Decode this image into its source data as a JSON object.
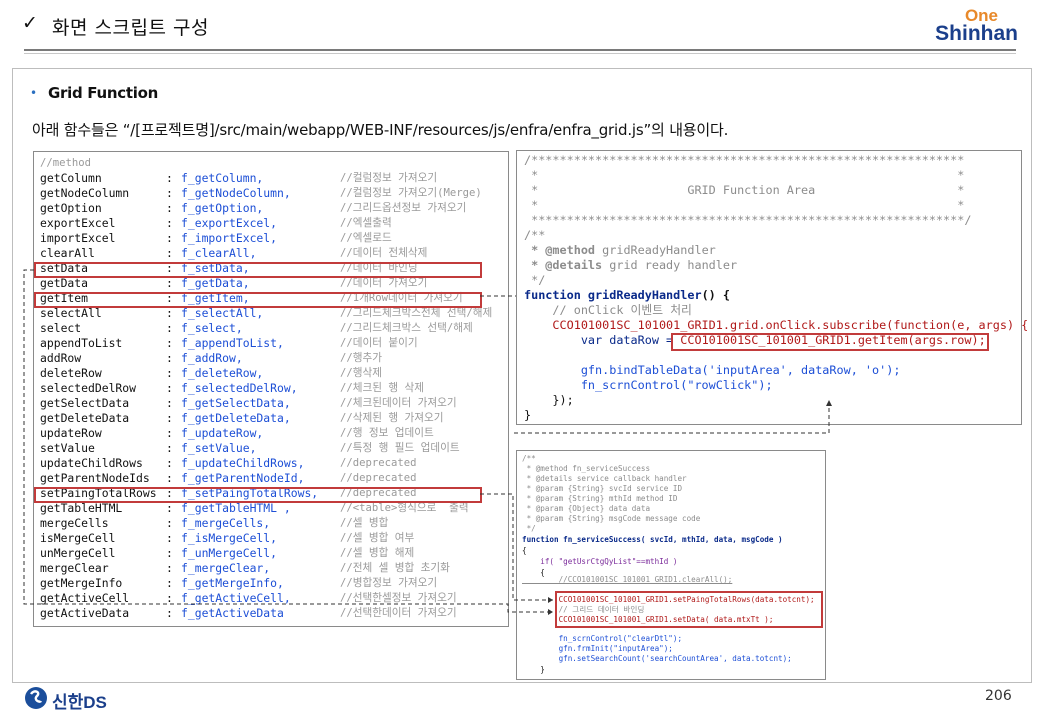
{
  "header": {
    "check": "✓",
    "title": "화면 스크립트 구성",
    "logo_top": "One",
    "logo_main": "Shinhan"
  },
  "section": {
    "bullet": "•",
    "title": "Grid Function",
    "description": "아래 함수들은 “/[프로젝트명]/src/main/webapp/WEB-INF/resources/js/enfra/enfra_grid.js”의 내용이다."
  },
  "left_code": {
    "header": "//method",
    "rows": [
      {
        "name": "getColumn",
        "fn": "f_getColumn,",
        "comment": "//컬럼정보 가져오기"
      },
      {
        "name": "getNodeColumn",
        "fn": "f_getNodeColumn,",
        "comment": "//컬럼정보 가져오기(Merge)"
      },
      {
        "name": "getOption",
        "fn": "f_getOption,",
        "comment": "//그리드옵션정보 가져오기"
      },
      {
        "name": "exportExcel",
        "fn": "f_exportExcel,",
        "comment": "//엑셀출력"
      },
      {
        "name": "importExcel",
        "fn": "f_importExcel,",
        "comment": "//엑셀로드"
      },
      {
        "name": "clearAll",
        "fn": "f_clearAll,",
        "comment": "//데이터 전체삭제"
      },
      {
        "name": "setData",
        "fn": "f_setData,",
        "comment": "//데이터 바인딩"
      },
      {
        "name": "getData",
        "fn": "f_getData,",
        "comment": "//데이터 가져오기"
      },
      {
        "name": "getItem",
        "fn": "f_getItem,",
        "comment": "//1개Row데이터 가져오기"
      },
      {
        "name": "selectAll",
        "fn": "f_selectAll,",
        "comment": "//그리드체크박스전체 선택/해제"
      },
      {
        "name": "select",
        "fn": "f_select,",
        "comment": "//그리드체크박스 선택/해제"
      },
      {
        "name": "appendToList",
        "fn": "f_appendToList,",
        "comment": "//데이터 붙이기"
      },
      {
        "name": "addRow",
        "fn": "f_addRow,",
        "comment": "//행추가"
      },
      {
        "name": "deleteRow",
        "fn": "f_deleteRow,",
        "comment": "//행삭제"
      },
      {
        "name": "selectedDelRow",
        "fn": "f_selectedDelRow,",
        "comment": "//체크된 행 삭제"
      },
      {
        "name": "getSelectData",
        "fn": "f_getSelectData,",
        "comment": "//체크된데이터 가져오기"
      },
      {
        "name": "getDeleteData",
        "fn": "f_getDeleteData,",
        "comment": "//삭제된 행 가져오기"
      },
      {
        "name": "updateRow",
        "fn": "f_updateRow,",
        "comment": "//행 정보 업데이트"
      },
      {
        "name": "setValue",
        "fn": "f_setValue,",
        "comment": "//특정 행 필드 업데이트"
      },
      {
        "name": "updateChildRows",
        "fn": "f_updateChildRows,",
        "comment": "//deprecated"
      },
      {
        "name": "getParentNodeIds",
        "fn": "f_getParentNodeId,",
        "comment": "//deprecated"
      },
      {
        "name": "setPaingTotalRows",
        "fn": "f_setPaingTotalRows,",
        "comment": "//deprecated"
      },
      {
        "name": "getTableHTML",
        "fn": "f_getTableHTML ,",
        "comment": "//<table>형식으로  출력"
      },
      {
        "name": "mergeCells",
        "fn": "f_mergeCells,",
        "comment": "//셀 병합"
      },
      {
        "name": "isMergeCell",
        "fn": "f_isMergeCell,",
        "comment": "//셀 병합 여부"
      },
      {
        "name": "unMergeCell",
        "fn": "f_unMergeCell,",
        "comment": "//셀 병합 해제"
      },
      {
        "name": "mergeClear",
        "fn": "f_mergeClear,",
        "comment": "//전체 셀 병합 초기화"
      },
      {
        "name": "getMergeInfo",
        "fn": "f_getMergeInfo,",
        "comment": "//병합정보 가져오기"
      },
      {
        "name": "getActiveCell",
        "fn": "f_getActiveCell,",
        "comment": "//선택한셀정보 가져오기"
      },
      {
        "name": "getActiveData",
        "fn": "f_getActiveData",
        "comment": "//선택한데이터 가져오기"
      }
    ]
  },
  "right_top_code": {
    "l1": "/*************************************************************",
    "l2": " *                                                           *",
    "l3": " *                     GRID Function Area                    *",
    "l4": " *                                                           *",
    "l5": " *************************************************************/",
    "l6": "/**",
    "l7_tag": " * @method",
    "l7_val": " gridReadyHandler",
    "l8_tag": " * @details",
    "l8_val": " grid ready handler",
    "l9": " */",
    "l10_kw": "function",
    "l10_name": " gridReadyHandler",
    "l10_rest": "() {",
    "l11": "    // onClick 이벤트 처리",
    "l12": "    CCO101001SC_101001_GRID1.grid.onClick.subscribe(function(e, args) {",
    "l13_pre": "        var dataRow = ",
    "l13_hl": "CCO101001SC_101001_GRID1.getItem(args.row);",
    "l14": "        gfn.bindTableData('inputArea', dataRow, 'o');",
    "l15": "        fn_scrnControl(\"rowClick\");",
    "l16": "    });",
    "l17": "}"
  },
  "right_bottom_code": {
    "l1": "/**",
    "l2": " * @method fn_serviceSuccess",
    "l3": " * @details service callback handler",
    "l4": " * @param {String} svcId service ID",
    "l5": " * @param {String} mthId method ID",
    "l6": " * @param {Object} data data",
    "l7": " * @param {String} msgCode message code",
    "l8": " */",
    "l9": "function fn_serviceSuccess( svcId, mthId, data, msgCode )",
    "l10": "{",
    "l11": "    if( \"getUsrCtgQyList\"==mthId )",
    "l12": "    {",
    "l13": "        //CCO101001SC_101001_GRID1.clearAll();",
    "l14": "        CCO101001SC_101001_GRID1.setPaingTotalRows(data.totcnt);",
    "l15": "        // 그리드 데이터 바인딩",
    "l16": "        CCO101001SC_101001_GRID1.setData( data.mtxTt );",
    "l17": "        fn_scrnControl(\"clearDtl\");",
    "l18": "        gfn.frmInit(\"inputArea\");",
    "l19": "        gfn.setSearchCount('searchCountArea', data.totcnt);",
    "l20": "    }"
  },
  "footer": {
    "logo_text": "신한DS",
    "page_number": "206"
  }
}
